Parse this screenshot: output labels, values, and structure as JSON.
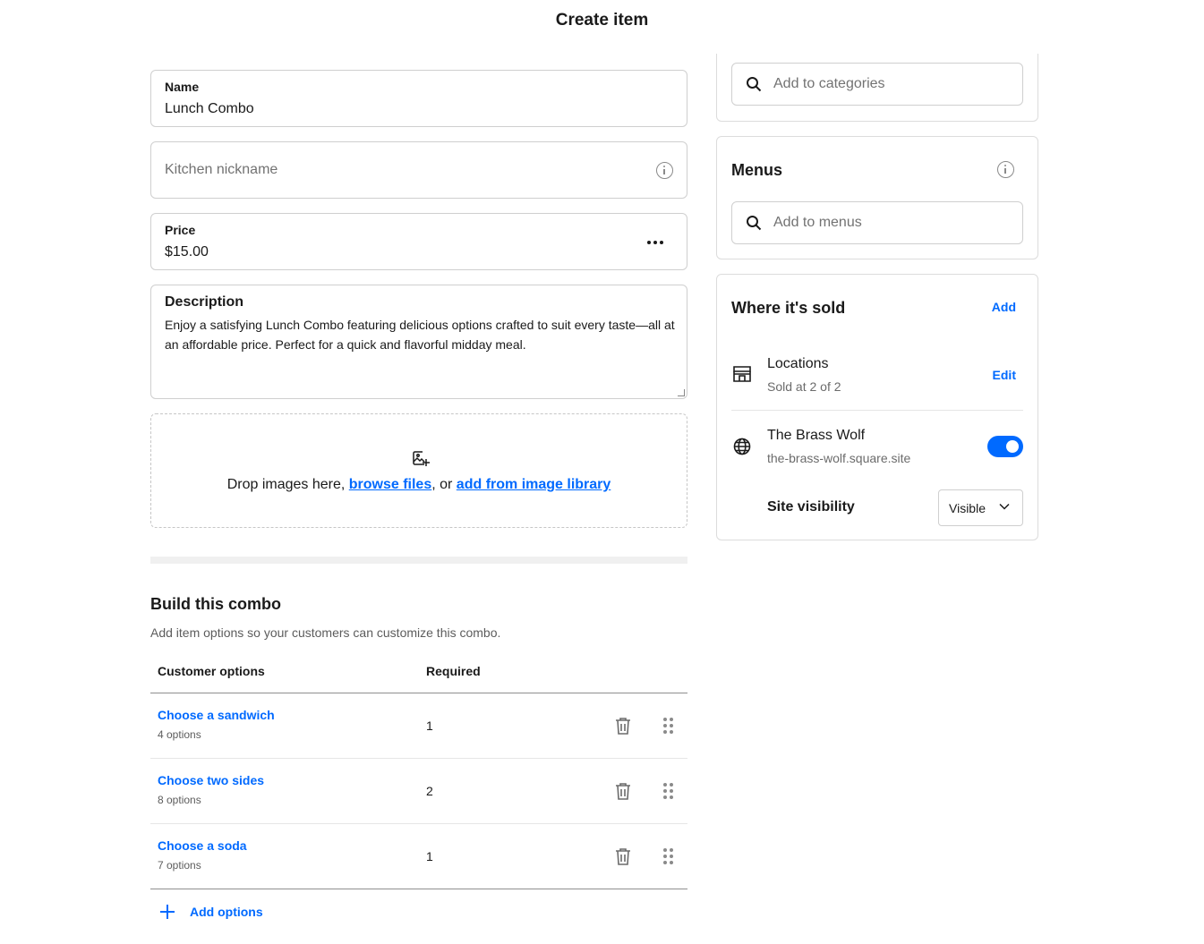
{
  "page": {
    "title": "Create item"
  },
  "form": {
    "name": {
      "label": "Name",
      "value": "Lunch Combo"
    },
    "kitchen_nickname": {
      "placeholder": "Kitchen nickname"
    },
    "price": {
      "label": "Price",
      "value": "$15.00"
    },
    "description": {
      "label": "Description",
      "value": "Enjoy a satisfying Lunch Combo featuring delicious options crafted to suit every taste—all at an affordable price. Perfect for a quick and flavorful midday meal."
    },
    "images": {
      "prefix": "Drop images here, ",
      "browse_link": "browse files",
      "separator": ", or ",
      "library_link": "add from image library"
    }
  },
  "combo": {
    "title": "Build this combo",
    "subtitle": "Add item options so your customers can customize this combo.",
    "columns": {
      "options": "Customer options",
      "required": "Required"
    },
    "rows": [
      {
        "name": "Choose a sandwich",
        "count": "4 options",
        "required": "1"
      },
      {
        "name": "Choose two sides",
        "count": "8 options",
        "required": "2"
      },
      {
        "name": "Choose a soda",
        "count": "7 options",
        "required": "1"
      }
    ],
    "add_label": "Add options"
  },
  "categories": {
    "placeholder": "Add to categories"
  },
  "menus": {
    "title": "Menus",
    "placeholder": "Add to menus"
  },
  "where_sold": {
    "title": "Where it's sold",
    "add_label": "Add",
    "locations": {
      "title": "Locations",
      "subtitle": "Sold at 2 of 2",
      "edit_label": "Edit"
    },
    "site": {
      "title": "The Brass Wolf",
      "url": "the-brass-wolf.square.site",
      "enabled": true
    },
    "visibility": {
      "label": "Site visibility",
      "value": "Visible"
    }
  },
  "colors": {
    "accent": "#006aff",
    "text": "#1a1a1a",
    "muted": "#727272",
    "border": "#cfcfcf"
  }
}
